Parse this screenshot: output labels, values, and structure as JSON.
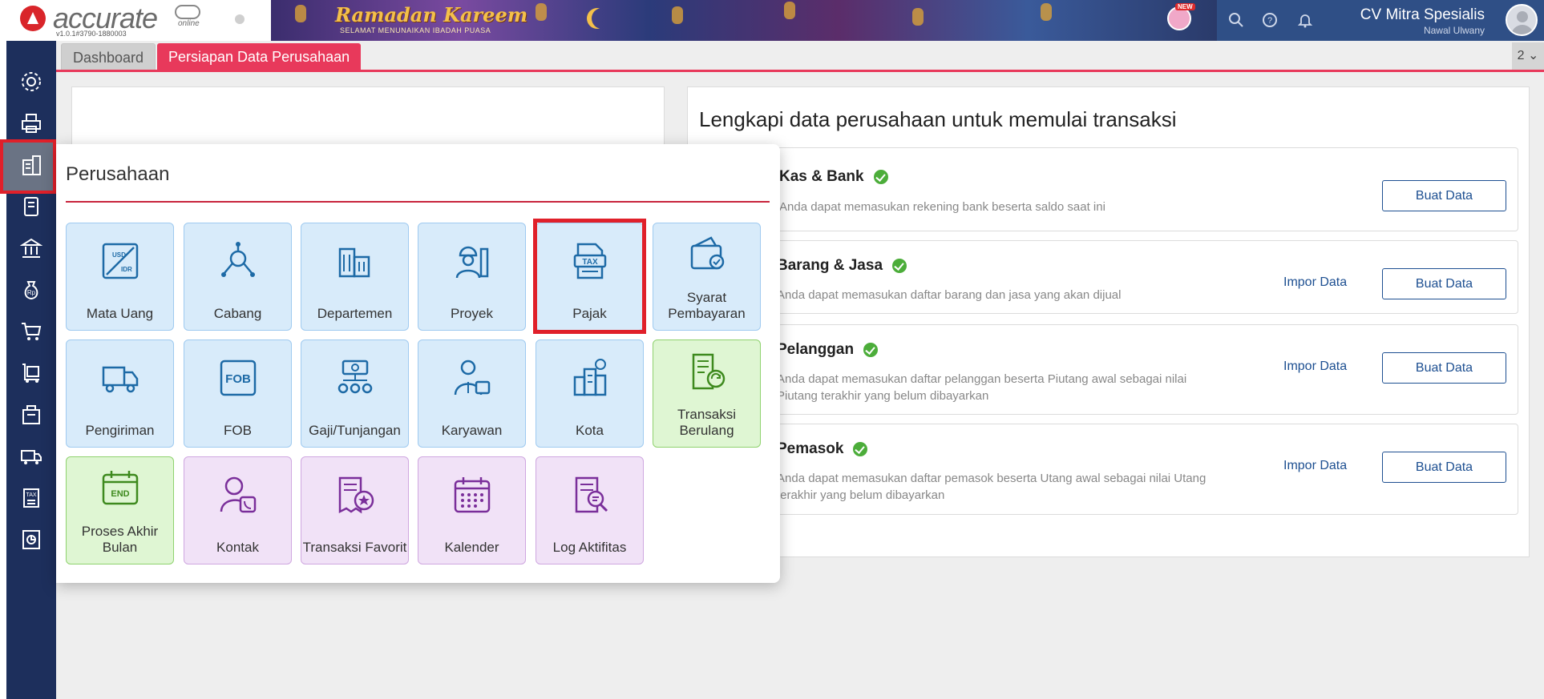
{
  "app": {
    "logo_text": "accurate",
    "logo_sub": "online",
    "version": "v1.0.1#3790-1880003",
    "banner_title": "Ramadan Kareem",
    "banner_sub": "SELAMAT MENUNAIKAN IBADAH PUASA",
    "new_badge": "NEW",
    "company": "CV Mitra Spesialis",
    "user": "Nawal Ulwany"
  },
  "sidebar": {
    "items": [
      "settings-icon",
      "printer-icon",
      "building-icon",
      "book-icon",
      "bank-icon",
      "money-bag-icon",
      "cart-icon",
      "trolley-icon",
      "warehouse-icon",
      "truck-icon",
      "tax-document-icon",
      "report-icon"
    ]
  },
  "tabs": {
    "dashboard": "Dashboard",
    "active": "Persiapan Data Perusahaan",
    "count": "2 ⌄"
  },
  "right_panel": {
    "title": "Lengkapi data perusahaan untuk memulai transaksi",
    "cards": [
      {
        "title": "Kas & Bank",
        "desc": "Anda dapat memasukan rekening bank beserta saldo saat ini",
        "impor": "",
        "buat": "Buat Data"
      },
      {
        "title": "Barang & Jasa",
        "desc": "Anda dapat memasukan daftar barang dan jasa yang akan dijual",
        "impor": "Impor Data",
        "buat": "Buat Data"
      },
      {
        "title": "Pelanggan",
        "desc": "Anda dapat memasukan daftar pelanggan beserta Piutang awal sebagai nilai Piutang terakhir yang belum dibayarkan",
        "impor": "Impor Data",
        "buat": "Buat Data"
      },
      {
        "title": "Pemasok",
        "desc": "Anda dapat memasukan daftar pemasok beserta Utang awal sebagai nilai Utang terakhir yang belum dibayarkan",
        "impor": "Impor Data",
        "buat": "Buat Data"
      }
    ]
  },
  "popup": {
    "title": "Perusahaan",
    "tiles": [
      {
        "label": "Mata Uang",
        "icon": "currency-exchange-icon",
        "color": "blue"
      },
      {
        "label": "Cabang",
        "icon": "branch-icon",
        "color": "blue"
      },
      {
        "label": "Departemen",
        "icon": "department-icon",
        "color": "blue"
      },
      {
        "label": "Proyek",
        "icon": "project-icon",
        "color": "blue"
      },
      {
        "label": "Pajak",
        "icon": "tax-icon",
        "color": "blue"
      },
      {
        "label": "Syarat Pembayaran",
        "icon": "payment-terms-icon",
        "color": "blue"
      },
      {
        "label": "Pengiriman",
        "icon": "delivery-truck-icon",
        "color": "blue"
      },
      {
        "label": "FOB",
        "icon": "fob-icon",
        "color": "blue"
      },
      {
        "label": "Gaji/Tunjangan",
        "icon": "salary-icon",
        "color": "blue"
      },
      {
        "label": "Karyawan",
        "icon": "employee-icon",
        "color": "blue"
      },
      {
        "label": "Kota",
        "icon": "city-icon",
        "color": "blue"
      },
      {
        "label": "Transaksi Berulang",
        "icon": "recurring-transaction-icon",
        "color": "green"
      },
      {
        "label": "Proses Akhir Bulan",
        "icon": "end-of-month-icon",
        "color": "green"
      },
      {
        "label": "Kontak",
        "icon": "contact-icon",
        "color": "purple"
      },
      {
        "label": "Transaksi Favorit",
        "icon": "favorite-transaction-icon",
        "color": "purple"
      },
      {
        "label": "Kalender",
        "icon": "calendar-icon",
        "color": "purple"
      },
      {
        "label": "Log Aktifitas",
        "icon": "activity-log-icon",
        "color": "purple"
      }
    ]
  },
  "colors": {
    "accent": "#e8395b",
    "sidebar": "#1d2f5c",
    "link": "#1d4f91",
    "check": "#4cad3a"
  }
}
